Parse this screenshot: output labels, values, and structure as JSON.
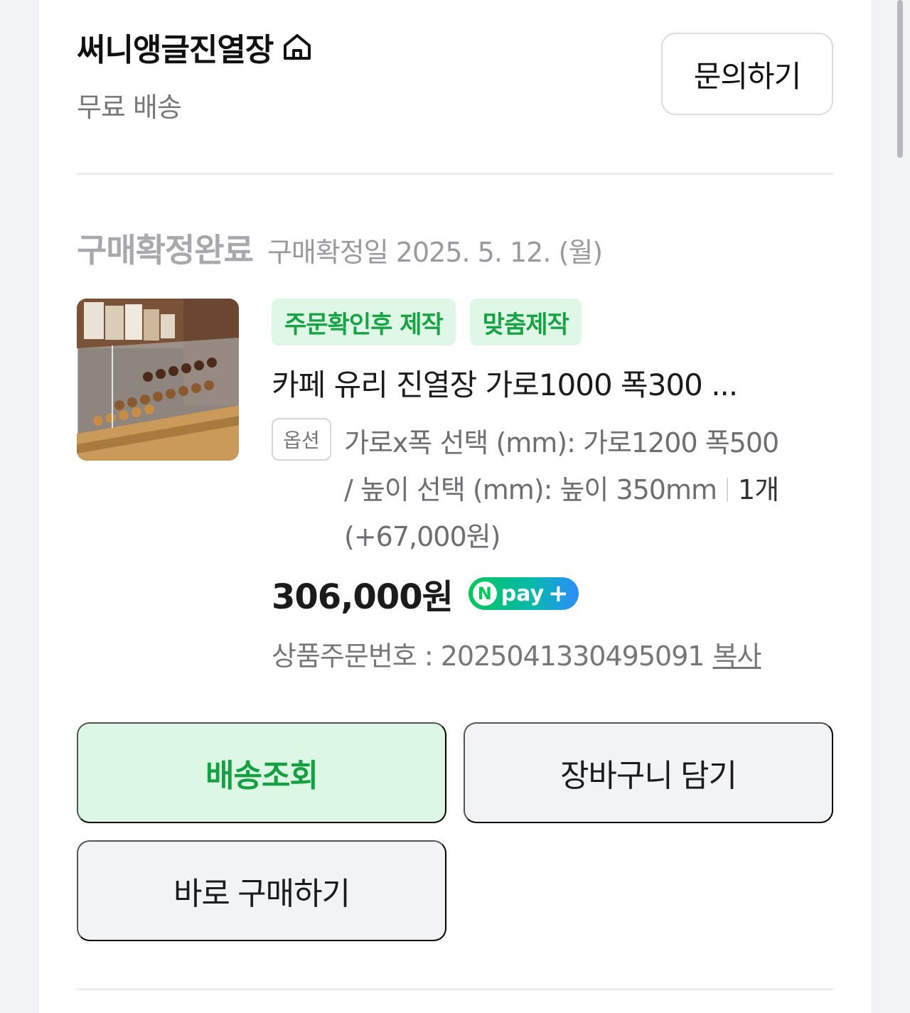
{
  "seller": {
    "name": "써니앵글진열장",
    "shipping": "무료 배송",
    "inquiry_label": "문의하기"
  },
  "order": {
    "status": "구매확정완료",
    "status_date": "구매확정일 2025. 5. 12. (월)",
    "tags": [
      "주문확인후 제작",
      "맞춤제작"
    ],
    "product_title": "카페 유리 진열장 가로1000 폭300 ...",
    "option_label": "옵션",
    "option_line1": "가로x폭 선택 (mm): 가로1200 폭500",
    "option_line2": "/ 높이 선택 (mm): 높이 350mm",
    "quantity": "1개",
    "option_price": "(+67,000원)",
    "price": "306,000원",
    "npay_label": "pay",
    "npay_n": "N",
    "npay_plus": "+",
    "order_number_label": "상품주문번호 : 2025041330495091",
    "copy_label": "복사"
  },
  "actions": {
    "track": "배송조회",
    "cart": "장바구니 담기",
    "buy": "바로 구매하기"
  },
  "colors": {
    "accent_green": "#16a043",
    "tag_bg": "#dff7e6",
    "muted": "#a9a9ad"
  }
}
